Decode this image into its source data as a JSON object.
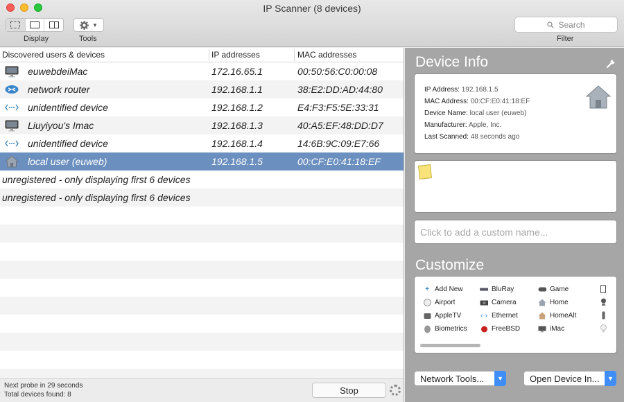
{
  "window": {
    "title": "IP Scanner (8 devices)"
  },
  "toolbar": {
    "display_label": "Display",
    "tools_label": "Tools",
    "filter_label": "Filter",
    "search_placeholder": "Search"
  },
  "table": {
    "headers": [
      "Discovered users & devices",
      "IP addresses",
      "MAC addresses"
    ],
    "rows": [
      {
        "icon": "imac-icon",
        "name": "euwebdeiMac",
        "ip": "172.16.65.1",
        "mac": "00:50:56:C0:00:08"
      },
      {
        "icon": "router-icon",
        "name": "network router",
        "ip": "192.168.1.1",
        "mac": "38:E2:DD:AD:44:80"
      },
      {
        "icon": "ethernet-icon",
        "name": "unidentified device",
        "ip": "192.168.1.2",
        "mac": "E4:F3:F5:5E:33:31"
      },
      {
        "icon": "imac-icon",
        "name": "Liuyiyou's Imac",
        "ip": "192.168.1.3",
        "mac": "40:A5:EF:48:DD:D7"
      },
      {
        "icon": "ethernet-icon",
        "name": "unidentified device",
        "ip": "192.168.1.4",
        "mac": "14:6B:9C:09:E7:66"
      },
      {
        "icon": "home-icon",
        "name": "local user (euweb)",
        "ip": "192.168.1.5",
        "mac": "00:CF:E0:41:18:EF"
      }
    ],
    "messages": [
      "unregistered - only displaying first 6 devices",
      "unregistered - only displaying first 6 devices"
    ]
  },
  "status": {
    "next_probe": "Next probe in 29 seconds",
    "total": "Total devices found: 8",
    "stop_label": "Stop"
  },
  "device_info": {
    "heading": "Device Info",
    "fields": [
      {
        "label": "IP Address:",
        "value": "192.168.1.5"
      },
      {
        "label": "MAC Address:",
        "value": "00:CF:E0:41:18:EF"
      },
      {
        "label": "Device Name:",
        "value": "local user (euweb)"
      },
      {
        "label": "Manufacturer:",
        "value": "Apple, Inc."
      },
      {
        "label": "Last Scanned:",
        "value": "48 seconds ago"
      }
    ],
    "custom_name_placeholder": "Click to add a custom name..."
  },
  "customize": {
    "heading": "Customize",
    "items": [
      {
        "label": "Add New",
        "icon": "plus-icon"
      },
      {
        "label": "Airport",
        "icon": "airport-icon"
      },
      {
        "label": "AppleTV",
        "icon": "appletv-icon"
      },
      {
        "label": "Biometrics",
        "icon": "fingerprint-icon"
      },
      {
        "label": "BluRay",
        "icon": "bluray-icon"
      },
      {
        "label": "Camera",
        "icon": "camera-icon"
      },
      {
        "label": "Ethernet",
        "icon": "ethernet-icon"
      },
      {
        "label": "FreeBSD",
        "icon": "freebsd-icon"
      },
      {
        "label": "Game",
        "icon": "gamepad-icon"
      },
      {
        "label": "Home",
        "icon": "home-icon"
      },
      {
        "label": "HomeAlt",
        "icon": "home-alt-icon"
      },
      {
        "label": "iMac",
        "icon": "imac-icon"
      }
    ]
  },
  "bottom_buttons": {
    "network_tools": "Network Tools...",
    "open_device": "Open Device In..."
  },
  "colors": {
    "selection": "#6b8fbe",
    "panel": "#a6a6a6",
    "popup_accent": "#3f8ef7"
  }
}
